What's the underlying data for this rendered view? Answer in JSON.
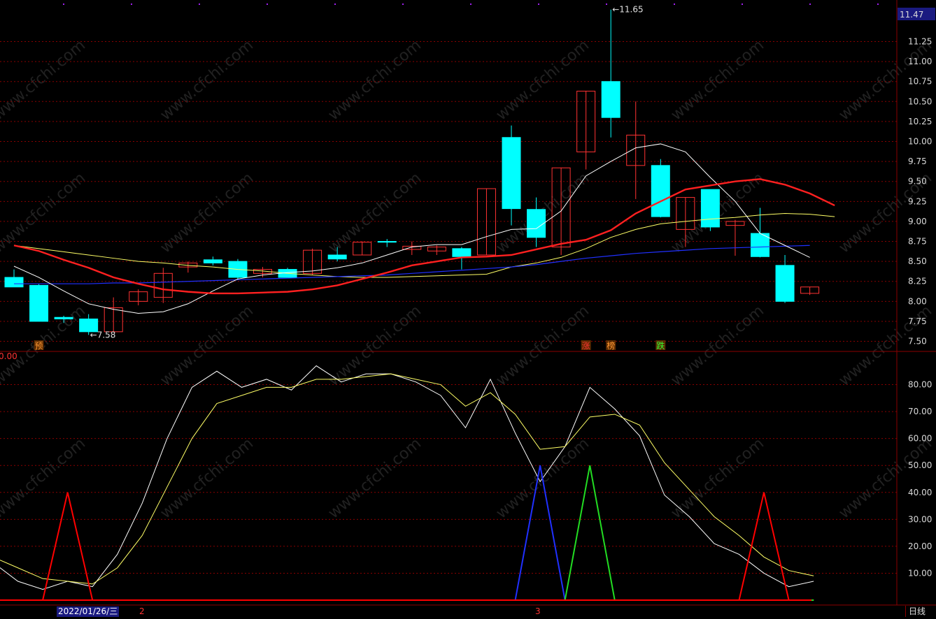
{
  "watermark": "www.cfchi.com",
  "colors": {
    "up": "#ff3232",
    "down": "#00ffff",
    "ma_white": "#ffffff",
    "ma_yellow": "#ffff66",
    "ma_red": "#ff2020",
    "ma_blue": "#2030ff",
    "grid": "#8b0000",
    "current_price_box": "#1a1a80"
  },
  "chart_data": [
    {
      "type": "candlestick",
      "title": "",
      "ylim": [
        7.4,
        11.7
      ],
      "y_ticks": [
        "11.25",
        "11.00",
        "10.75",
        "10.50",
        "10.25",
        "10.00",
        "9.75",
        "9.50",
        "9.25",
        "9.00",
        "8.75",
        "8.50",
        "8.25",
        "8.00",
        "7.75",
        "7.50"
      ],
      "current_price": "11.47",
      "grid": true,
      "candles": [
        {
          "o": 8.3,
          "h": 8.4,
          "l": 8.18,
          "c": 8.18
        },
        {
          "o": 8.2,
          "h": 8.22,
          "l": 7.75,
          "c": 7.75
        },
        {
          "o": 7.8,
          "h": 7.82,
          "l": 7.73,
          "c": 7.78
        },
        {
          "o": 7.78,
          "h": 7.84,
          "l": 7.58,
          "c": 7.62
        },
        {
          "o": 7.62,
          "h": 8.05,
          "l": 7.62,
          "c": 7.92
        },
        {
          "o": 8.0,
          "h": 8.15,
          "l": 7.95,
          "c": 8.12
        },
        {
          "o": 8.05,
          "h": 8.42,
          "l": 7.98,
          "c": 8.35
        },
        {
          "o": 8.43,
          "h": 8.5,
          "l": 8.36,
          "c": 8.48
        },
        {
          "o": 8.52,
          "h": 8.56,
          "l": 8.45,
          "c": 8.48
        },
        {
          "o": 8.5,
          "h": 8.53,
          "l": 8.27,
          "c": 8.3
        },
        {
          "o": 8.35,
          "h": 8.43,
          "l": 8.3,
          "c": 8.4
        },
        {
          "o": 8.4,
          "h": 8.42,
          "l": 8.3,
          "c": 8.3
        },
        {
          "o": 8.35,
          "h": 8.66,
          "l": 8.33,
          "c": 8.64
        },
        {
          "o": 8.58,
          "h": 8.68,
          "l": 8.5,
          "c": 8.53
        },
        {
          "o": 8.58,
          "h": 8.75,
          "l": 8.58,
          "c": 8.74
        },
        {
          "o": 8.75,
          "h": 8.78,
          "l": 8.68,
          "c": 8.74
        },
        {
          "o": 8.65,
          "h": 8.75,
          "l": 8.58,
          "c": 8.69
        },
        {
          "o": 8.63,
          "h": 8.7,
          "l": 8.58,
          "c": 8.68
        },
        {
          "o": 8.66,
          "h": 8.68,
          "l": 8.4,
          "c": 8.56
        },
        {
          "o": 8.58,
          "h": 9.41,
          "l": 8.58,
          "c": 9.41
        },
        {
          "o": 10.05,
          "h": 10.2,
          "l": 8.95,
          "c": 9.16
        },
        {
          "o": 9.15,
          "h": 9.3,
          "l": 8.68,
          "c": 8.8
        },
        {
          "o": 8.68,
          "h": 9.67,
          "l": 8.58,
          "c": 9.67
        },
        {
          "o": 9.87,
          "h": 10.63,
          "l": 9.65,
          "c": 10.63
        },
        {
          "o": 10.75,
          "h": 11.65,
          "l": 10.05,
          "c": 10.3
        },
        {
          "o": 9.7,
          "h": 10.5,
          "l": 9.28,
          "c": 10.08
        },
        {
          "o": 9.7,
          "h": 9.78,
          "l": 9.05,
          "c": 9.06
        },
        {
          "o": 8.9,
          "h": 9.3,
          "l": 8.68,
          "c": 9.3
        },
        {
          "o": 9.4,
          "h": 9.4,
          "l": 8.88,
          "c": 8.93
        },
        {
          "o": 8.95,
          "h": 9.02,
          "l": 8.57,
          "c": 9.0
        },
        {
          "o": 8.85,
          "h": 9.17,
          "l": 8.55,
          "c": 8.56
        },
        {
          "o": 8.45,
          "h": 8.58,
          "l": 7.98,
          "c": 8.0
        },
        {
          "o": 8.1,
          "h": 8.18,
          "l": 8.08,
          "c": 8.18
        }
      ],
      "ma_white": [
        8.44,
        8.3,
        8.13,
        7.97,
        7.9,
        7.85,
        7.87,
        7.97,
        8.13,
        8.28,
        8.33,
        8.36,
        8.38,
        8.42,
        8.48,
        8.58,
        8.68,
        8.71,
        8.71,
        8.81,
        8.9,
        8.91,
        9.13,
        9.57,
        9.75,
        9.92,
        9.97,
        9.87,
        9.55,
        9.25,
        8.85,
        8.7,
        8.55
      ],
      "ma_red": [
        8.7,
        8.63,
        8.52,
        8.42,
        8.3,
        8.22,
        8.15,
        8.12,
        8.1,
        8.1,
        8.11,
        8.12,
        8.15,
        8.2,
        8.28,
        8.36,
        8.45,
        8.5,
        8.55,
        8.56,
        8.58,
        8.65,
        8.72,
        8.77,
        8.89,
        9.1,
        9.25,
        9.4,
        9.45,
        9.5,
        9.53,
        9.46,
        9.35,
        9.2
      ],
      "ma_yellow": [
        8.7,
        8.66,
        8.62,
        8.58,
        8.54,
        8.5,
        8.48,
        8.45,
        8.43,
        8.4,
        8.38,
        8.35,
        8.33,
        8.31,
        8.3,
        8.3,
        8.31,
        8.32,
        8.33,
        8.34,
        8.43,
        8.48,
        8.55,
        8.66,
        8.8,
        8.9,
        8.97,
        9.0,
        9.03,
        9.05,
        9.08,
        9.1,
        9.09,
        9.06
      ],
      "ma_blue": [
        8.22,
        8.22,
        8.22,
        8.22,
        8.23,
        8.23,
        8.24,
        8.25,
        8.26,
        8.27,
        8.28,
        8.29,
        8.3,
        8.31,
        8.32,
        8.33,
        8.35,
        8.37,
        8.39,
        8.41,
        8.43,
        8.46,
        8.5,
        8.54,
        8.57,
        8.6,
        8.62,
        8.64,
        8.66,
        8.67,
        8.68,
        8.69,
        8.7
      ],
      "annotations": [
        {
          "label": "11.65",
          "candle": 24,
          "value": 11.65
        },
        {
          "label": "7.58",
          "candle": 3,
          "value": 7.58
        }
      ],
      "markers": [
        {
          "label": "预",
          "candle": 1,
          "color": "#ff9933"
        },
        {
          "label": "涨",
          "candle": 23,
          "color": "#ff3333"
        },
        {
          "label": "榜",
          "candle": 24,
          "color": "#ff9933"
        },
        {
          "label": "跌",
          "candle": 26,
          "color": "#33ff33"
        }
      ]
    },
    {
      "type": "line",
      "title": "",
      "ylim": [
        0,
        90
      ],
      "y_ticks": [
        "80.00",
        "70.00",
        "60.00",
        "50.00",
        "40.00",
        "30.00",
        "20.00",
        "10.00"
      ],
      "top_label": "0.00",
      "grid": true,
      "series": [
        {
          "color": "#ffffff",
          "values": [
            14,
            7,
            4,
            7,
            5,
            17,
            36,
            60,
            79,
            85,
            79,
            82,
            78,
            87,
            81,
            84,
            84,
            81,
            76,
            64,
            82,
            62,
            44,
            57,
            79,
            71,
            61,
            39,
            31,
            21,
            17,
            10,
            5,
            7
          ]
        },
        {
          "color": "#ffff66",
          "values": [
            16,
            12,
            8,
            7,
            6,
            12,
            24,
            42,
            60,
            73,
            76,
            79,
            79,
            82,
            82,
            83,
            84,
            82,
            80,
            72,
            77,
            69,
            56,
            57,
            68,
            69,
            65,
            51,
            41,
            31,
            24,
            16,
            11,
            9
          ]
        },
        {
          "color": "#ff0000",
          "values": [
            0,
            0,
            0,
            40,
            0,
            0,
            0,
            0,
            0,
            0,
            0,
            0,
            0,
            0,
            0,
            0,
            0,
            0,
            0,
            0,
            0,
            0,
            0,
            0,
            0,
            0,
            0,
            0,
            0,
            0,
            0,
            40,
            0,
            0
          ]
        },
        {
          "color": "#2030ff",
          "values": [
            0,
            0,
            0,
            0,
            0,
            0,
            0,
            0,
            0,
            0,
            0,
            0,
            0,
            0,
            0,
            0,
            0,
            0,
            0,
            0,
            0,
            0,
            50,
            0,
            0,
            0,
            0,
            0,
            0,
            0,
            0,
            0,
            0,
            0
          ]
        },
        {
          "color": "#22dd22",
          "values": [
            0,
            0,
            0,
            0,
            0,
            0,
            0,
            0,
            0,
            0,
            0,
            0,
            0,
            0,
            0,
            0,
            0,
            0,
            0,
            0,
            0,
            0,
            0,
            0,
            50,
            0,
            0,
            0,
            0,
            0,
            0,
            0,
            0,
            0
          ]
        }
      ]
    }
  ],
  "status_bar": {
    "date": "2022/01/26/三",
    "label_2": "2",
    "label_3": "3",
    "period": "日线"
  }
}
